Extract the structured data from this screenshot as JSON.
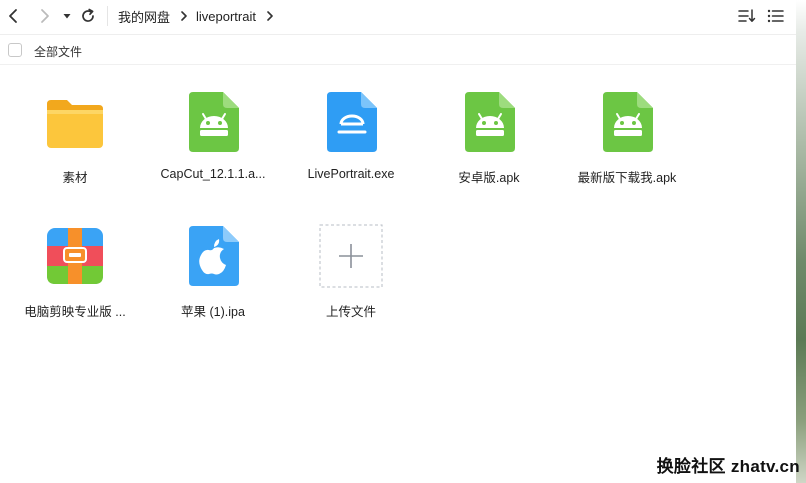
{
  "toolbar": {
    "back_icon": "chevron-left-icon",
    "forward_icon": "chevron-right-icon",
    "history_icon": "caret-down-icon",
    "refresh_icon": "refresh-icon",
    "sort_icon": "sort-list-icon",
    "list_view_icon": "list-view-icon"
  },
  "breadcrumb": {
    "items": [
      "我的网盘",
      "liveportrait"
    ]
  },
  "selection": {
    "select_all_label": "全部文件"
  },
  "files": [
    {
      "name": "素材",
      "type": "folder",
      "icon": "folder-icon"
    },
    {
      "name": "CapCut_12.1.1.a...",
      "type": "apk",
      "icon": "android-apk-icon"
    },
    {
      "name": "LivePortrait.exe",
      "type": "exe",
      "icon": "exe-file-icon"
    },
    {
      "name": "安卓版.apk",
      "type": "apk",
      "icon": "android-apk-icon"
    },
    {
      "name": "最新版下载我.apk",
      "type": "apk",
      "icon": "android-apk-icon"
    },
    {
      "name": "电脑剪映专业版 ...",
      "type": "archive",
      "icon": "archive-icon"
    },
    {
      "name": "苹果 (1).ipa",
      "type": "ipa",
      "icon": "apple-ipa-icon"
    },
    {
      "name": "上传文件",
      "type": "upload",
      "icon": "upload-plus-icon"
    }
  ],
  "colors": {
    "apk_green": "#6cc644",
    "exe_blue": "#2f9df4",
    "ipa_blue": "#3aa3f5",
    "folder_yellow": "#fbc23a"
  },
  "watermark": "换脸社区 zhatv.cn"
}
